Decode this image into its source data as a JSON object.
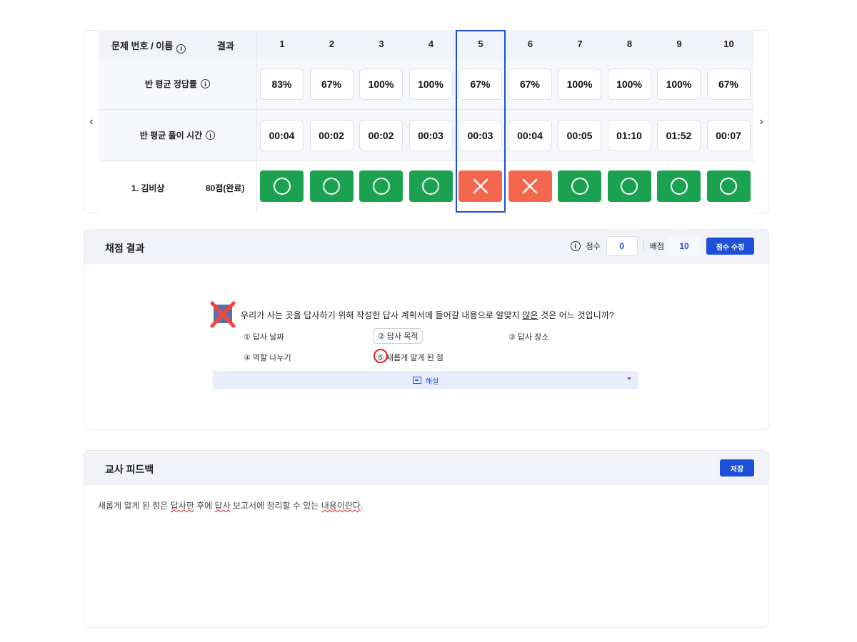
{
  "grade_table": {
    "header": {
      "name_label": "문제 번호 / 이름",
      "result_label": "결과",
      "info_icon": "info-circle-icon"
    },
    "questions": [
      "1",
      "2",
      "3",
      "4",
      "5",
      "6",
      "7",
      "8",
      "9",
      "10"
    ],
    "rate_row": {
      "label": "반 평균 정답률",
      "values": [
        "83%",
        "67%",
        "100%",
        "100%",
        "67%",
        "67%",
        "100%",
        "100%",
        "100%",
        "67%"
      ]
    },
    "time_row": {
      "label": "반 평균 풀이 시간",
      "values": [
        "00:04",
        "00:02",
        "00:02",
        "00:03",
        "00:03",
        "00:04",
        "00:05",
        "01:10",
        "01:52",
        "00:07"
      ]
    },
    "student": {
      "name": "1. 김비상",
      "score": "80점(완료)",
      "results": [
        "O",
        "O",
        "O",
        "O",
        "X",
        "X",
        "O",
        "O",
        "O",
        "O"
      ]
    },
    "selected_question": "5",
    "colors": {
      "correct": "#1aa251",
      "wrong": "#f5664f",
      "highlight": "#1d4fd8"
    },
    "prev_arrow": "‹",
    "next_arrow": "›"
  },
  "scoring": {
    "title": "채점 결과",
    "score_label": "점수",
    "score_value": "0",
    "points_label": "배점",
    "points_value": "10",
    "edit_button": "점수 수정",
    "question_text_a": "우리가 사는 곳을 답사하기 위해 작성한 답사 계획서에 들어갈 내용으로 알맞지 ",
    "question_text_b": "않은",
    "question_text_c": " 것은 어느 것입니까?",
    "options": [
      "① 답사 날짜",
      "② 답사 목적",
      "③ 답사 장소",
      "④ 역할 나누기",
      "⑤ 새롭게 알게 된 점"
    ],
    "selected_option": "② 답사 목적",
    "correct_option": "⑤ 새롭게 알게 된 점",
    "explain_label": "해설"
  },
  "feedback": {
    "title": "교사 피드백",
    "save_button": "저장",
    "text_a": "새롭게 알게 된 점은 ",
    "text_b": "답사한",
    "text_c": " 후에 ",
    "text_d": "답사",
    "text_e": " 보고서에 정리할 수 있는 ",
    "text_f": "내용이란다",
    "text_g": "."
  }
}
